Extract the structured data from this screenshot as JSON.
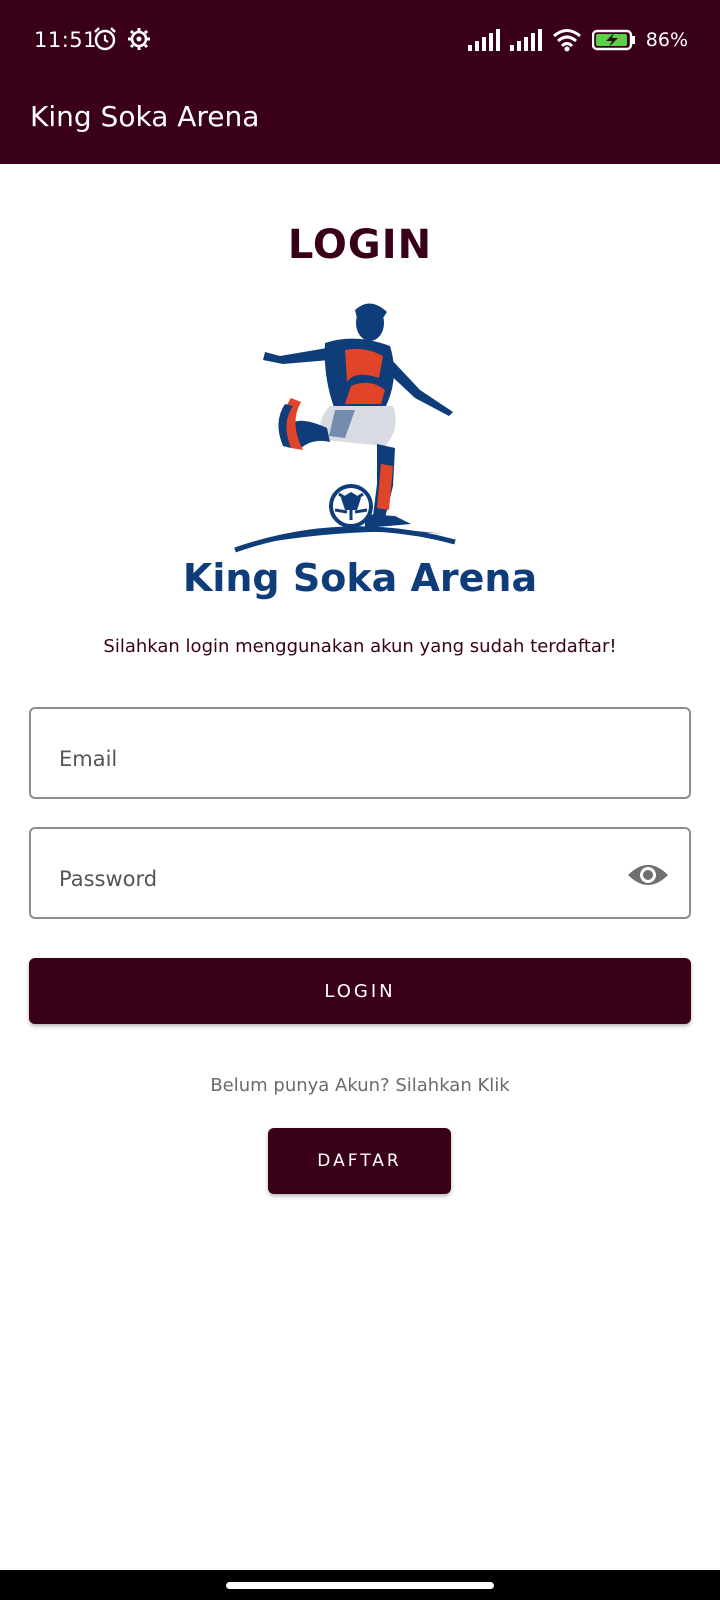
{
  "status_bar": {
    "time": "11:51",
    "battery_percent": "86%",
    "left_icons": [
      "alarm-icon",
      "settings-icon"
    ],
    "right_icons": [
      "signal-icon",
      "signal-icon",
      "wifi-icon",
      "battery-charging-icon"
    ]
  },
  "app_bar": {
    "title": "King Soka Arena"
  },
  "login": {
    "heading": "LOGIN",
    "logo_text": "King Soka Arena",
    "subtitle": "Silahkan login menggunakan akun yang sudah terdaftar!",
    "email_placeholder": "Email",
    "password_placeholder": "Password",
    "login_button": "LOGIN",
    "register_hint": "Belum punya Akun? Silahkan Klik",
    "register_button": "DAFTAR"
  },
  "colors": {
    "primary": "#3a0019",
    "logo_blue": "#0f3d7a",
    "logo_red": "#e0452a",
    "field_border": "#8d8d8d"
  }
}
